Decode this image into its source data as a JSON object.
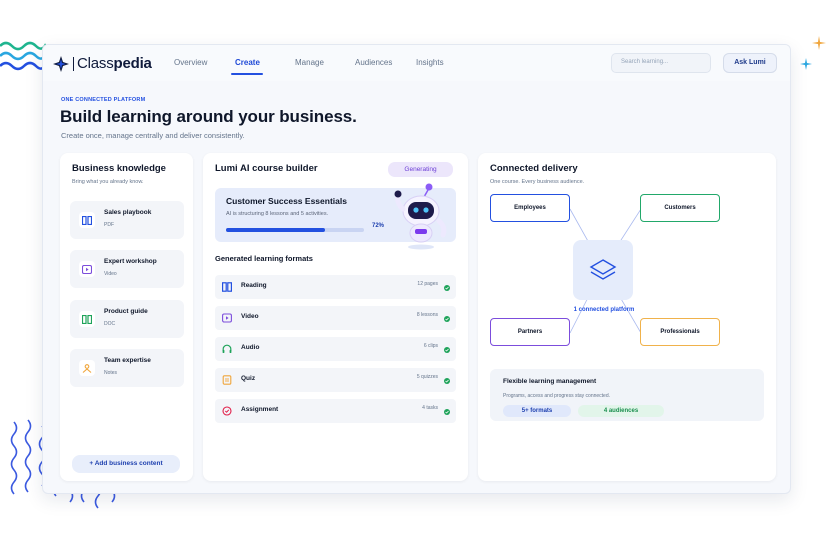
{
  "brand": {
    "name_light": "Class",
    "name_bold": "pedia"
  },
  "nav": {
    "items": [
      "Overview",
      "Create",
      "Manage",
      "Audiences",
      "Insights"
    ],
    "active": "Create"
  },
  "search": {
    "placeholder": "Search learning..."
  },
  "ask_button": {
    "label": "Ask Lumi"
  },
  "hero": {
    "eyebrow": "ONE CONNECTED PLATFORM",
    "title": "Build learning around your business.",
    "subtitle": "Create once, manage centrally and deliver consistently."
  },
  "knowledge": {
    "title": "Business knowledge",
    "subtitle": "Bring what you already know.",
    "items": [
      {
        "label": "Sales playbook",
        "meta": "PDF",
        "icon": "book-icon"
      },
      {
        "label": "Expert workshop",
        "meta": "Video",
        "icon": "play-icon"
      },
      {
        "label": "Product guide",
        "meta": "DOC",
        "icon": "book-icon"
      },
      {
        "label": "Team expertise",
        "meta": "Notes",
        "icon": "person-icon"
      }
    ],
    "add_label": "+ Add business content"
  },
  "builder": {
    "title": "Lumi AI course builder",
    "status": "Generating",
    "course_title": "Customer Success Essentials",
    "course_desc": "AI is structuring 8 lessons and 5 activities.",
    "progress_text": "72%",
    "progress": 0.72,
    "formats_title": "Generated learning formats",
    "formats": [
      {
        "label": "Reading",
        "meta": "12 pages",
        "icon": "book-icon"
      },
      {
        "label": "Video",
        "meta": "8 lessons",
        "icon": "play-icon"
      },
      {
        "label": "Audio",
        "meta": "6 clips",
        "icon": "headphones-icon"
      },
      {
        "label": "Quiz",
        "meta": "5 quizzes",
        "icon": "quiz-icon"
      },
      {
        "label": "Assignment",
        "meta": "4 tasks",
        "icon": "target-icon"
      }
    ]
  },
  "delivery": {
    "title": "Connected delivery",
    "subtitle": "One course. Every business audience.",
    "nodes": [
      "Employees",
      "Customers",
      "Partners",
      "Professionals"
    ],
    "hub_label": "1 connected platform",
    "flex_title": "Flexible learning management",
    "flex_desc": "Programs, access and progress stay connected.",
    "pills": [
      "5+ formats",
      "4 audiences"
    ]
  },
  "colors": {
    "accent": "#2350e0",
    "purple": "#7c4ddc",
    "green": "#1ea35a",
    "amber": "#f0a53a",
    "employees_border": "#2350e0",
    "customers_border": "#22a86a",
    "partners_border": "#7c4ddc",
    "professionals_border": "#f0b24b"
  }
}
